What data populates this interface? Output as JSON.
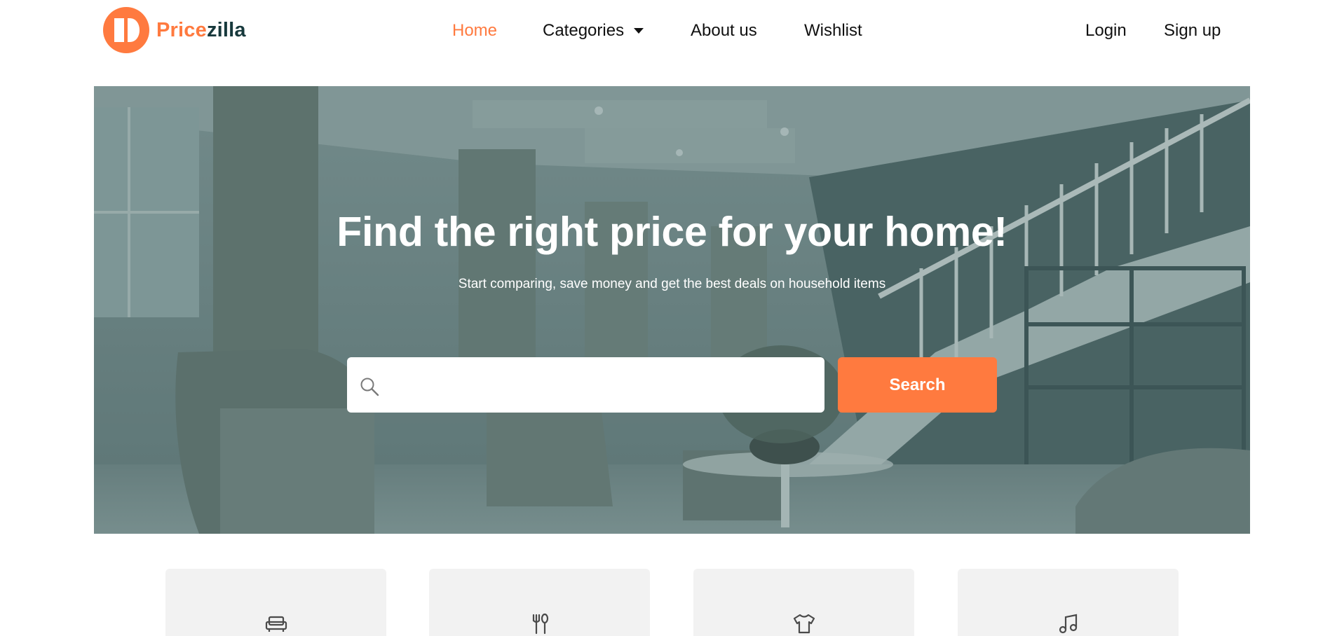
{
  "brand": {
    "name_part1": "Price",
    "name_part2": "zilla",
    "primary_color": "#ff7a3f",
    "dark_color": "#17393c"
  },
  "nav": {
    "home": "Home",
    "categories": "Categories",
    "about": "About us",
    "wishlist": "Wishlist",
    "login": "Login",
    "signup": "Sign up",
    "active_item": "home"
  },
  "hero": {
    "title": "Find the right price for your home!",
    "subtitle": "Start comparing, save money and get the best deals on household items",
    "background": "living-room-with-staircase-photo",
    "search": {
      "placeholder": "",
      "value": "",
      "button_label": "Search"
    }
  },
  "categories": [
    {
      "icon": "sofa-icon"
    },
    {
      "icon": "fork-spoon-icon"
    },
    {
      "icon": "tshirt-icon"
    },
    {
      "icon": "music-note-icon"
    }
  ]
}
